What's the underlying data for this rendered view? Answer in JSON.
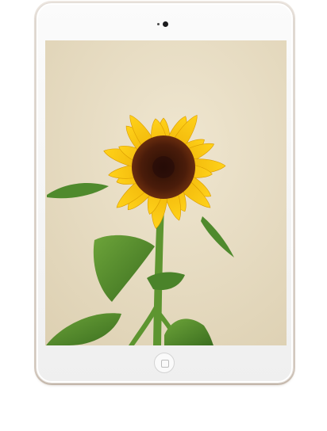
{
  "device": {
    "type": "tablet",
    "color": "#f7f7f7",
    "frame_color": "#e0d6cc"
  },
  "screen": {
    "wallpaper": {
      "subject": "sunflower",
      "background_color": "#e9dfc8",
      "petal_color": "#f7c80d",
      "center_color": "#4a1c0a",
      "leaf_color": "#4f8a2d"
    }
  },
  "icons": {
    "camera": "camera-icon",
    "speaker": "speaker-icon",
    "home": "home-button-icon"
  }
}
